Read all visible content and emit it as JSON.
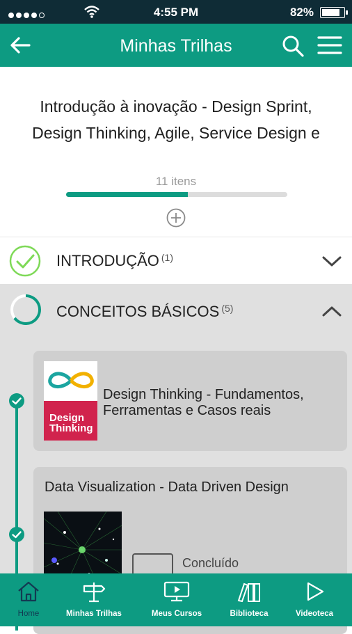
{
  "status_bar": {
    "time": "4:55 PM",
    "battery": "82%",
    "battery_level": 0.82
  },
  "app_bar": {
    "title": "Minhas Trilhas"
  },
  "trail": {
    "title": "Introdução à inovação - Design Sprint, Design Thinking, Agile, Service Design e",
    "items_count": "11 itens",
    "progress": 0.55
  },
  "sections": [
    {
      "title": "INTRODUÇÃO",
      "count": "(1)"
    },
    {
      "title": "CONCEITOS BÁSICOS",
      "count": "(5)"
    }
  ],
  "courses": [
    {
      "title": "Design Thinking - Fundamentos, Ferramentas e Casos reais",
      "thumb_text": "Design Thinking"
    },
    {
      "title": "Data Visualization - Data Driven Design",
      "status": "Concluído"
    }
  ],
  "bottom_nav": [
    {
      "label": "Home",
      "icon": "home-icon"
    },
    {
      "label": "Minhas Trilhas",
      "icon": "signpost-icon"
    },
    {
      "label": "Meus Cursos",
      "icon": "monitor-play-icon"
    },
    {
      "label": "Biblioteca",
      "icon": "books-icon"
    },
    {
      "label": "Videoteca",
      "icon": "play-icon"
    }
  ],
  "colors": {
    "primary": "#0d9b82",
    "status_bar": "#0f2c36",
    "active_tab": "#133a52",
    "intro_check": "#7ed957",
    "thumb_red": "#d1234d"
  }
}
